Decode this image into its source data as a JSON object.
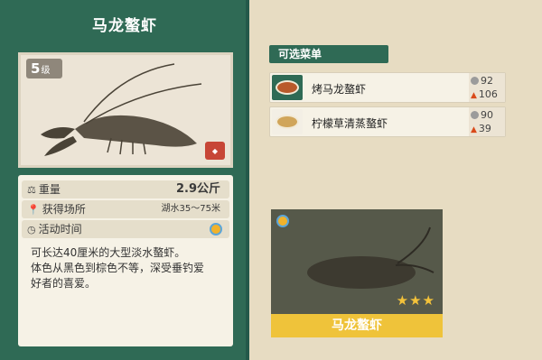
{
  "detail": {
    "title": "马龙螯虾",
    "level": "5",
    "level_unit": "级",
    "stats": {
      "weight_label": "重量",
      "weight_value": "2.9公斤",
      "location_label": "获得场所",
      "location_value": "湖水35～75米",
      "time_label": "活动时间"
    },
    "description": [
      "可长达40厘米的大型淡水螯虾。",
      "体色从黑色到棕色不等，深受垂钓爱",
      "好者的喜爱。"
    ]
  },
  "menu": {
    "header": "可选菜单",
    "items": [
      {
        "name": "烤马龙螯虾",
        "price": "92",
        "energy": "106"
      },
      {
        "name": "柠檬草清蒸螯虾",
        "price": "90",
        "energy": "39"
      }
    ]
  },
  "card": {
    "name": "马龙螯虾",
    "stars": "★★★"
  },
  "icons": {
    "weight": "scale-icon",
    "location": "map-pin-icon",
    "time": "clock-icon",
    "price": "coin-icon",
    "energy": "flame-icon"
  }
}
